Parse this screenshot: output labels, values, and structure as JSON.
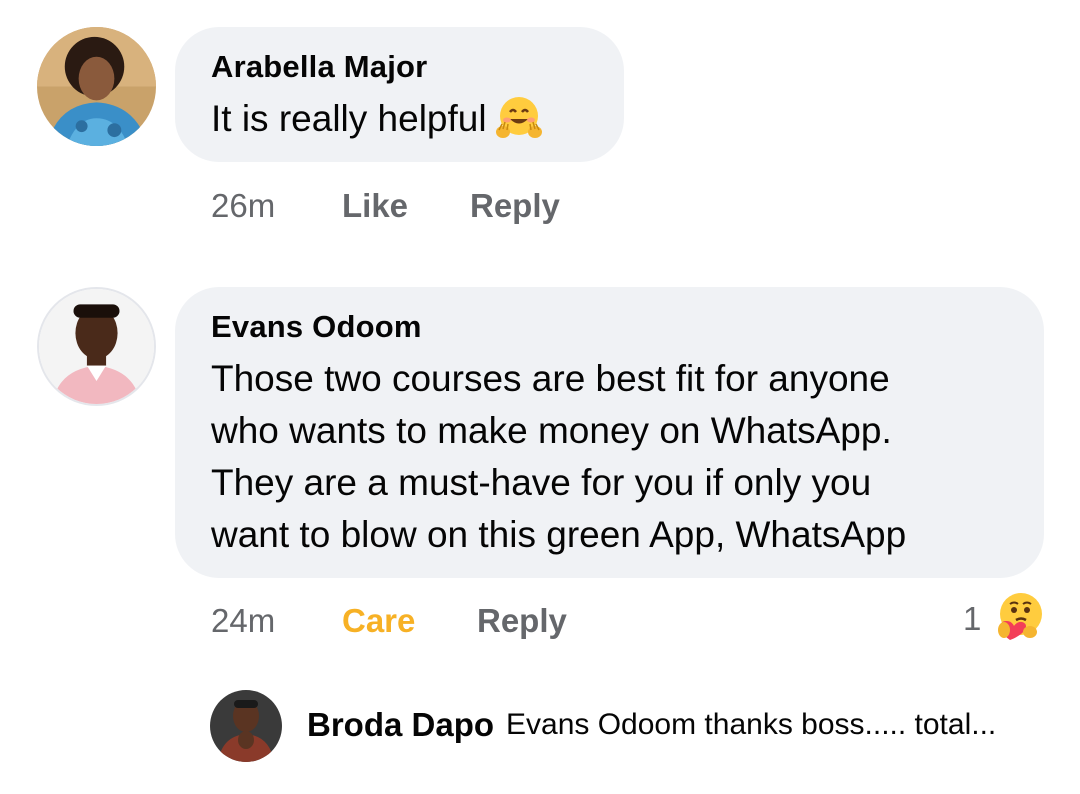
{
  "comments": [
    {
      "author": "Arabella Major",
      "text_lines": [
        "It is really helpful"
      ],
      "emoji": "hugging-face-emoji",
      "time": "26m",
      "reaction_label": "Like",
      "reply_label": "Reply"
    },
    {
      "author": "Evans Odoom",
      "text_lines": [
        "Those two courses are best fit for anyone",
        "who wants to make money on WhatsApp.",
        "They are a must-have for you if only you",
        "want to blow on this green App, WhatsApp"
      ],
      "time": "24m",
      "reaction_label": "Care",
      "reply_label": "Reply",
      "reaction_count": "1",
      "reaction_icon": "care-emoji",
      "reaction_color": "#f7b125"
    }
  ],
  "reply_preview": {
    "author": "Broda Dapo",
    "text": "Evans Odoom thanks boss..... total..."
  }
}
